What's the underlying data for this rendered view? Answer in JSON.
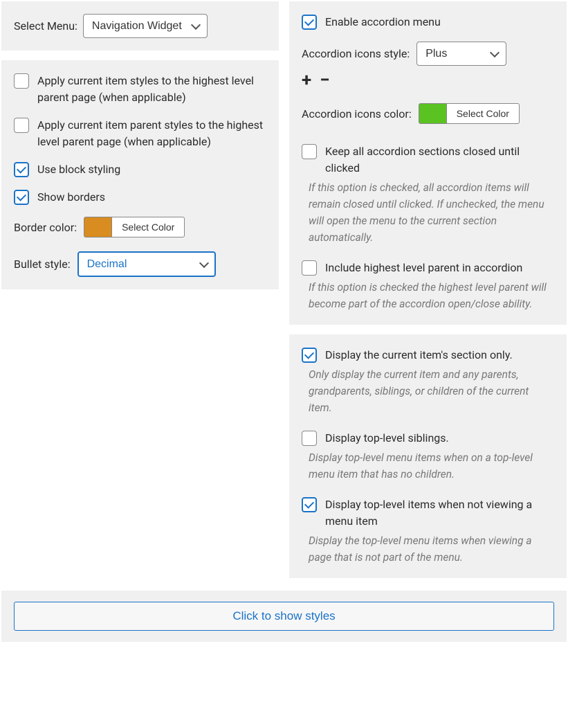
{
  "panel1": {
    "select_menu_label": "Select Menu:",
    "select_menu_value": "Navigation Widget"
  },
  "panel2": {
    "apply_current_item_styles": "Apply current item styles to the highest level parent page (when applicable)",
    "apply_current_item_parent_styles": "Apply current item parent styles to the highest level parent page (when applicable)",
    "use_block_styling": "Use block styling",
    "show_borders": "Show borders",
    "border_color_label": "Border color:",
    "select_color": "Select Color",
    "bullet_style_label": "Bullet style:",
    "bullet_style_value": "Decimal"
  },
  "panel3": {
    "enable_accordion": "Enable accordion menu",
    "accordion_icons_style_label": "Accordion icons style:",
    "accordion_icons_style_value": "Plus",
    "plus_icon": "+",
    "minus_icon": "−",
    "accordion_icons_color_label": "Accordion icons color:",
    "select_color": "Select Color",
    "keep_closed_label": "Keep all accordion sections closed until clicked",
    "keep_closed_desc": "If this option is checked, all accordion items will remain closed until clicked. If unchecked, the menu will open the menu to the current section automatically.",
    "include_parent_label": "Include highest level parent in accordion",
    "include_parent_desc": "If this option is checked the highest level parent will become part of the accordion open/close ability."
  },
  "panel4": {
    "display_current_label": "Display the current item's section only.",
    "display_current_desc": "Only display the current item and any parents, grandparents, siblings, or children of the current item.",
    "display_top_siblings_label": "Display top-level siblings.",
    "display_top_siblings_desc": "Display top-level menu items when on a top-level menu item that has no children.",
    "display_top_items_label": "Display top-level items when not viewing a menu item",
    "display_top_items_desc": "Display the top-level menu items when viewing a page that is not part of the menu."
  },
  "footer": {
    "show_styles": "Click to show styles"
  },
  "colors": {
    "border_color": "#d98c1f",
    "accordion_icon_color": "#5ac221"
  }
}
